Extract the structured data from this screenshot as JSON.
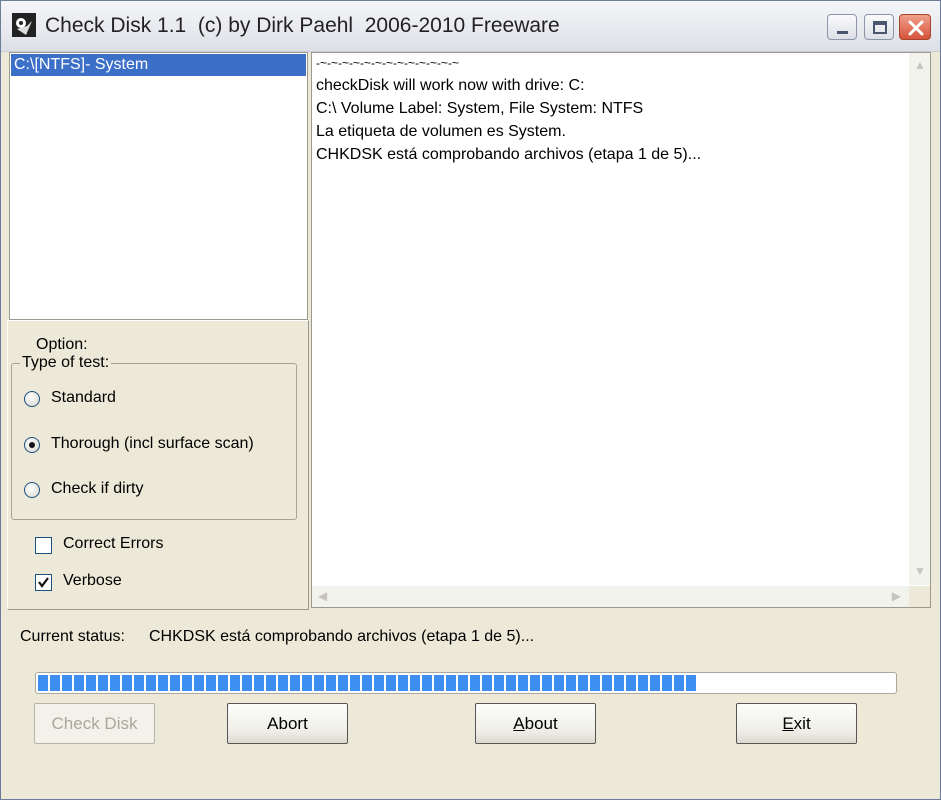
{
  "window": {
    "title": "Check Disk 1.1  (c) by Dirk Paehl  2006-2010 Freeware",
    "icons": [
      "app-icon",
      "minimize-icon",
      "maximize-icon",
      "close-icon"
    ]
  },
  "drives": {
    "items": [
      {
        "label": "C:\\[NTFS]- System",
        "selected": true
      }
    ]
  },
  "options": {
    "title": "Option:",
    "test_group_label": "Type of test:",
    "radios": [
      {
        "label": "Standard",
        "checked": false
      },
      {
        "label": "Thorough (incl surface scan)",
        "checked": true
      },
      {
        "label": "Check if dirty",
        "checked": false
      }
    ],
    "checkboxes": [
      {
        "label": "Correct Errors",
        "checked": false
      },
      {
        "label": "Verbose",
        "checked": true
      }
    ]
  },
  "log": {
    "lines": [
      "-~-~-~-~-~-~-~-~-~-~-~-~-~",
      "checkDisk will work now with drive: C:",
      "C:\\ Volume Label: System, File System: NTFS",
      "La etiqueta de volumen es System.",
      "CHKDSK está comprobando archivos (etapa 1 de 5)..."
    ]
  },
  "status": {
    "label": "Current status:",
    "value": "CHKDSK está comprobando archivos (etapa 1 de 5)..."
  },
  "progress": {
    "fraction": 0.77,
    "color": "#3c8ff0"
  },
  "buttons": {
    "check_disk": "Check Disk",
    "abort": "Abort",
    "about": "About",
    "exit": "Exit"
  },
  "colors": {
    "selection": "#3b6fc8",
    "window_bg": "#ece9d8"
  }
}
